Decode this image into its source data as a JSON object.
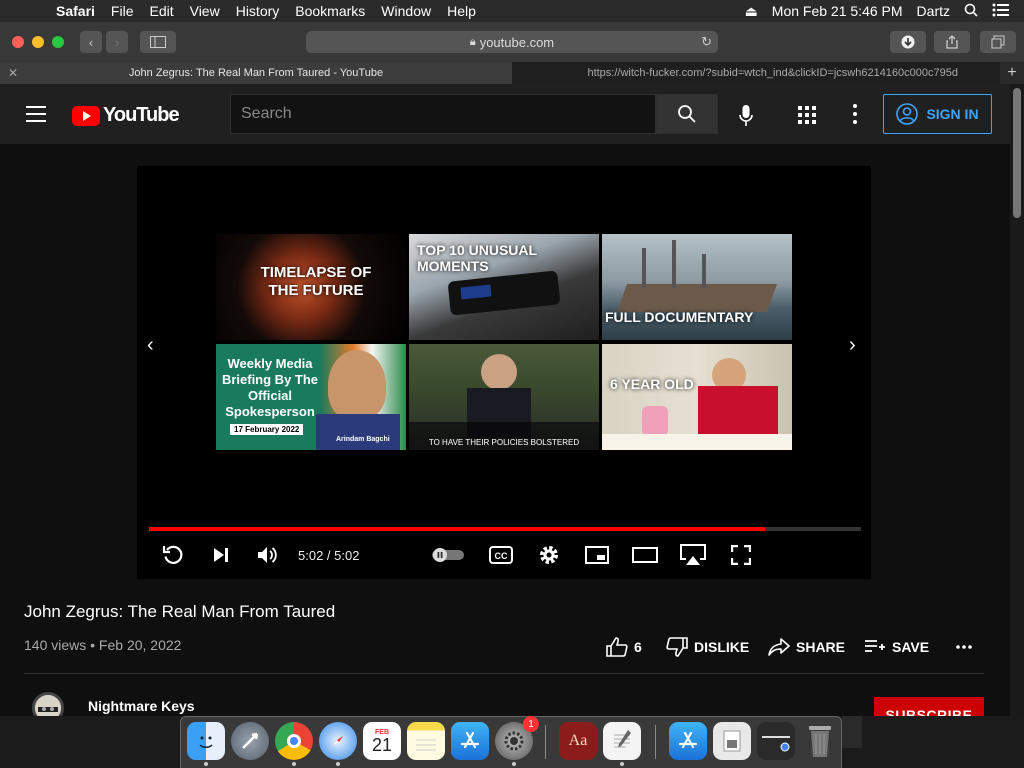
{
  "menubar": {
    "app": "Safari",
    "items": [
      "File",
      "Edit",
      "View",
      "History",
      "Bookmarks",
      "Window",
      "Help"
    ],
    "datetime": "Mon Feb 21  5:46 PM",
    "user": "Dartz"
  },
  "browser": {
    "url": "youtube.com",
    "tabs": [
      {
        "title": "John Zegrus: The Real Man From Taured - YouTube",
        "active": true
      },
      {
        "title": "https://witch-fucker.com/?subid=wtch_ind&clickID=jcswh6214160c000c795d",
        "active": false
      }
    ]
  },
  "youtube": {
    "logo": "YouTube",
    "search_placeholder": "Search",
    "signin_label": "SIGN IN"
  },
  "player": {
    "time": "5:02 / 5:02",
    "progress_fraction": 1.0,
    "end_screen": [
      {
        "text": "TIMELAPSE OF THE FUTURE"
      },
      {
        "text": "TOP 10 UNUSUAL MOMENTS"
      },
      {
        "text": "FULL DOCUMENTARY"
      },
      {
        "text": "Weekly Media Briefing By The Official Spokesperson",
        "sub": "17 February 2022",
        "name": "Arindam Bagchi"
      },
      {
        "text": "TO HAVE THEIR POLICIES BOLSTERED"
      },
      {
        "text": "6 YEAR OLD"
      }
    ]
  },
  "video": {
    "title": "John Zegrus: The Real Man From Taured",
    "meta": "140 views • Feb 20, 2022",
    "likes": "6",
    "dislike_label": "DISLIKE",
    "share_label": "SHARE",
    "save_label": "SAVE"
  },
  "channel": {
    "name": "Nightmare Keys",
    "subscribe_label": "SUBSCRIBE"
  },
  "dock": {
    "calendar_day": "21",
    "calendar_month": "FEB",
    "badge_count": "1"
  }
}
